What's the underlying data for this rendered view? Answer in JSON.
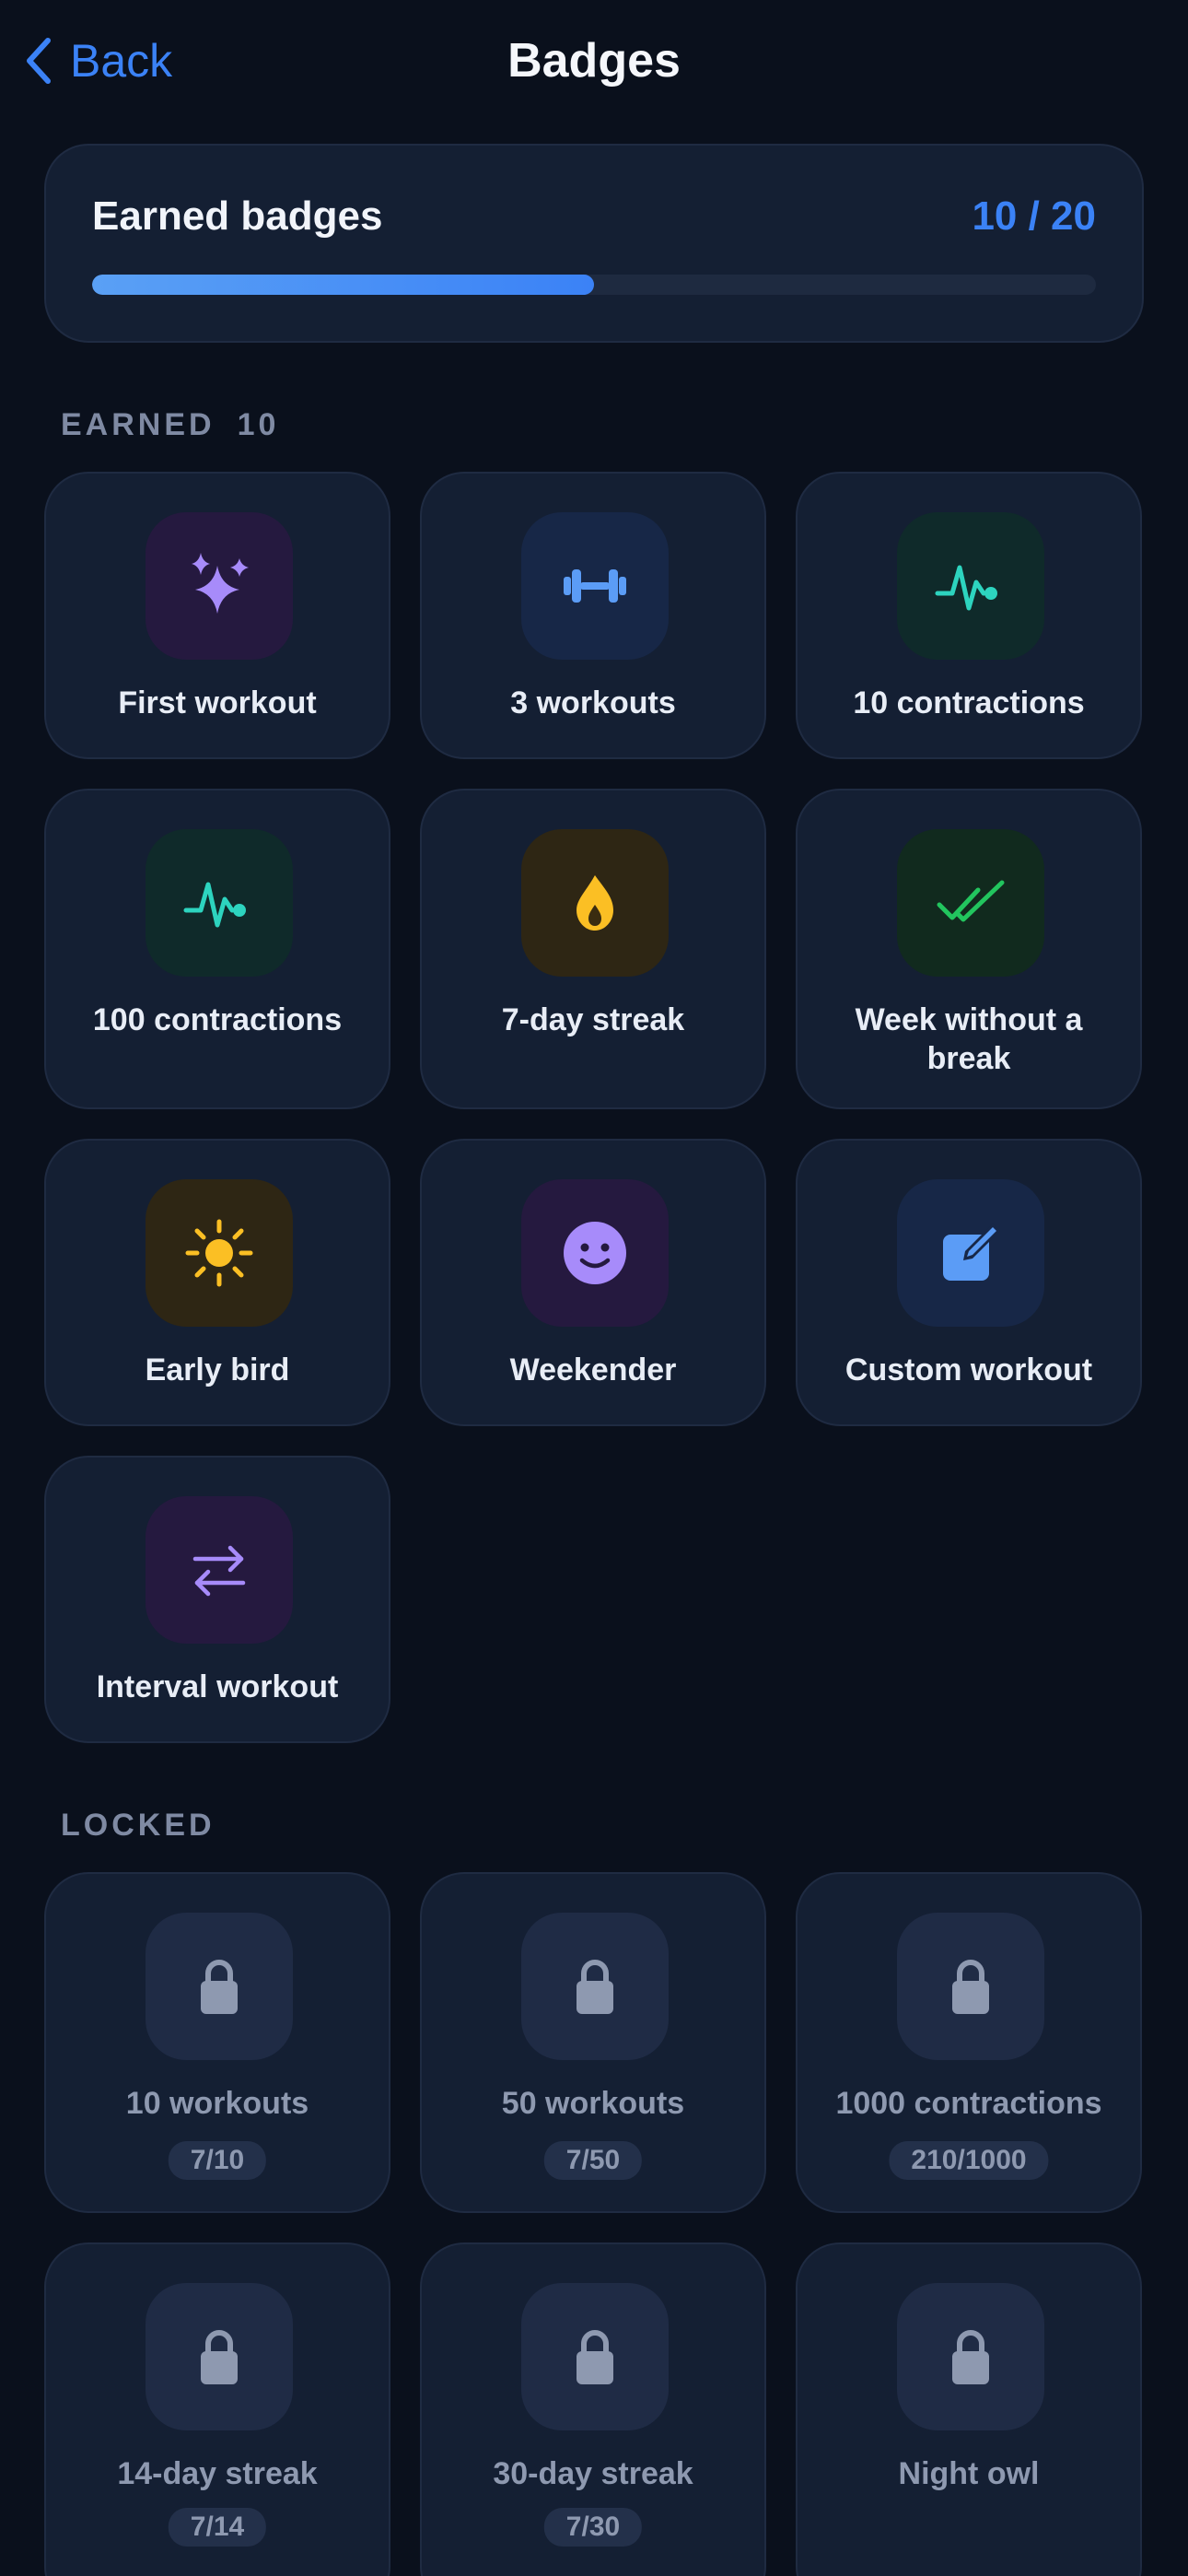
{
  "header": {
    "back_label": "Back",
    "title": "Badges"
  },
  "progress": {
    "label": "Earned badges",
    "count": "10 / 20",
    "fraction": 0.5
  },
  "earned_section": {
    "title": "EARNED",
    "count": "10"
  },
  "locked_section": {
    "title": "LOCKED"
  },
  "earned": [
    {
      "label": "First workout",
      "icon": "sparkles-icon"
    },
    {
      "label": "3 workouts",
      "icon": "dumbbell-icon"
    },
    {
      "label": "10 contractions",
      "icon": "pulse-icon"
    },
    {
      "label": "100 contractions",
      "icon": "pulse-icon"
    },
    {
      "label": "7-day streak",
      "icon": "flame-icon"
    },
    {
      "label": "Week without a break",
      "icon": "double-check-icon"
    },
    {
      "label": "Early bird",
      "icon": "sun-icon"
    },
    {
      "label": "Weekender",
      "icon": "smile-icon"
    },
    {
      "label": "Custom workout",
      "icon": "edit-icon"
    },
    {
      "label": "Interval workout",
      "icon": "swap-arrows-icon"
    }
  ],
  "locked": [
    {
      "label": "10 workouts",
      "progress": "7/10",
      "icon": "lock-icon"
    },
    {
      "label": "50 workouts",
      "progress": "7/50",
      "icon": "lock-icon"
    },
    {
      "label": "1000 contractions",
      "progress": "210/1000",
      "icon": "lock-icon"
    },
    {
      "label": "14-day streak",
      "progress": "7/14",
      "icon": "lock-icon"
    },
    {
      "label": "30-day streak",
      "progress": "7/30",
      "icon": "lock-icon"
    },
    {
      "label": "Night owl",
      "icon": "lock-icon"
    }
  ],
  "colors": {
    "accent": "#3b82f6",
    "background": "#0a101c",
    "card": "#141f33",
    "purple": "#a78bfa",
    "teal": "#2dd4bf",
    "amber": "#fbbf24",
    "green": "#22c55e",
    "lock": "#8e99b0"
  }
}
